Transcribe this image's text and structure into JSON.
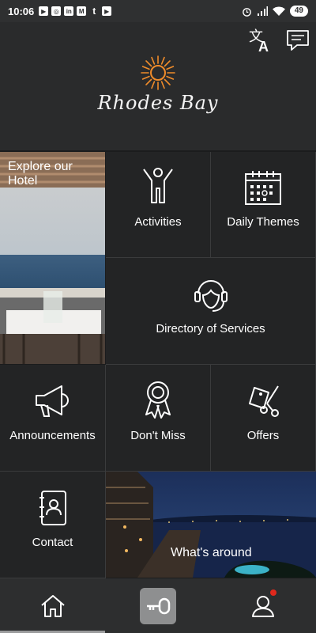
{
  "status_bar": {
    "time": "10:06",
    "battery": "49",
    "notif_icons": [
      "youtube-icon",
      "instagram-icon",
      "linkedin-icon",
      "gmail-icon",
      "tumblr-icon",
      "youtube-icon"
    ]
  },
  "header": {
    "logo_text": "Rhodes Bay",
    "translate_icon": "translate-icon",
    "chat_icon": "chat-icon"
  },
  "tiles": {
    "explore": "Explore our Hotel",
    "activities": "Activities",
    "daily_themes": "Daily Themes",
    "directory": "Directory of Services",
    "announcements": "Announcements",
    "dont_miss": "Don't Miss",
    "offers": "Offers",
    "contact": "Contact",
    "whats_around": "What's around"
  },
  "bottom_nav": {
    "home": "home-icon",
    "key": "key-icon",
    "profile": "profile-icon"
  },
  "colors": {
    "accent_orange": "#f08c2a",
    "tile_bg": "#232425",
    "badge_red": "#e0281c"
  }
}
